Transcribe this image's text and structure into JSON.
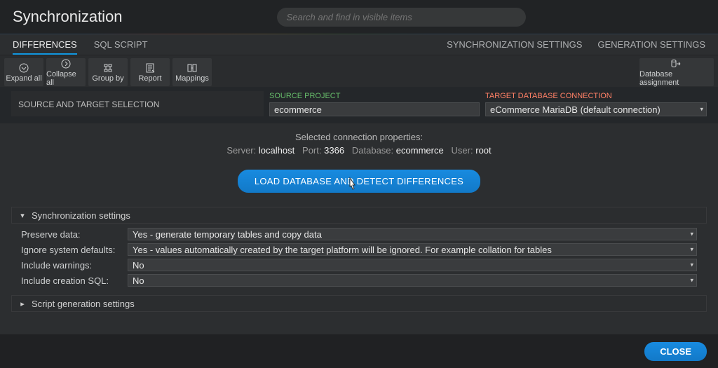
{
  "header": {
    "title": "Synchronization",
    "search_placeholder": "Search and find in visible items"
  },
  "tabs": {
    "left": [
      {
        "label": "DIFFERENCES",
        "active": true
      },
      {
        "label": "SQL SCRIPT",
        "active": false
      }
    ],
    "right": [
      {
        "label": "SYNCHRONIZATION SETTINGS"
      },
      {
        "label": "GENERATION SETTINGS"
      }
    ]
  },
  "toolbar": {
    "expand_all": "Expand all",
    "collapse_all": "Collapse all",
    "group_by": "Group by",
    "report": "Report",
    "mappings": "Mappings",
    "db_assignment": "Database assignment"
  },
  "selection": {
    "row_label": "SOURCE AND TARGET SELECTION",
    "source_caption": "SOURCE PROJECT",
    "source_value": "ecommerce",
    "target_caption": "TARGET DATABASE CONNECTION",
    "target_value": "eCommerce MariaDB (default connection)"
  },
  "conn": {
    "heading": "Selected connection properties:",
    "server_label": "Server:",
    "server_value": "localhost",
    "port_label": "Port:",
    "port_value": "3366",
    "database_label": "Database:",
    "database_value": "ecommerce",
    "user_label": "User:",
    "user_value": "root",
    "load_button": "LOAD DATABASE AND DETECT DIFFERENCES"
  },
  "sync_settings": {
    "section_title": "Synchronization settings",
    "rows": [
      {
        "label": "Preserve data:",
        "value": "Yes - generate temporary tables and copy data"
      },
      {
        "label": "Ignore system defaults:",
        "value": "Yes - values automatically created by the target platform will be ignored. For example collation for tables"
      },
      {
        "label": "Include warnings:",
        "value": "No"
      },
      {
        "label": "Include creation SQL:",
        "value": "No"
      }
    ]
  },
  "script_settings": {
    "section_title": "Script generation settings"
  },
  "footer": {
    "close": "CLOSE"
  }
}
